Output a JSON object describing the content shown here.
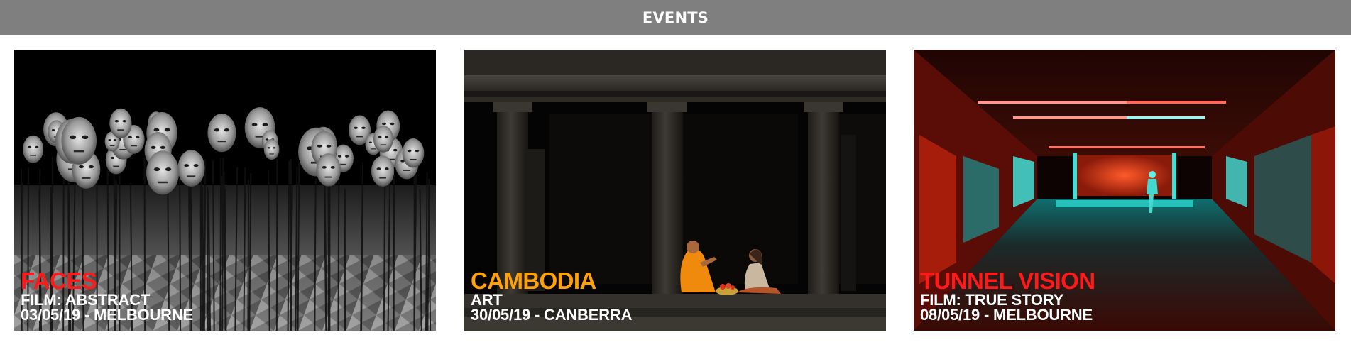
{
  "header": {
    "title": "EVENTS",
    "background": "#7f7f7f"
  },
  "events": [
    {
      "title": "FACES",
      "category": "FILM: ABSTRACT",
      "date_location": "03/05/19 - MELBOURNE",
      "title_color": "#ff1a1a",
      "image_subject": "field of masks on poles, black and white"
    },
    {
      "title": "CAMBODIA",
      "category": "ART",
      "date_location": "30/05/19 - CANBERRA",
      "title_color": "#ffa10a",
      "image_subject": "monk and woman praying at a temple colonnade"
    },
    {
      "title": "TUNNEL VISION",
      "category": "FILM: TRUE STORY",
      "date_location": "08/05/19 - MELBOURNE",
      "title_color": "#ff1a1a",
      "image_subject": "red and cyan lit tunnel with a walking figure"
    }
  ]
}
